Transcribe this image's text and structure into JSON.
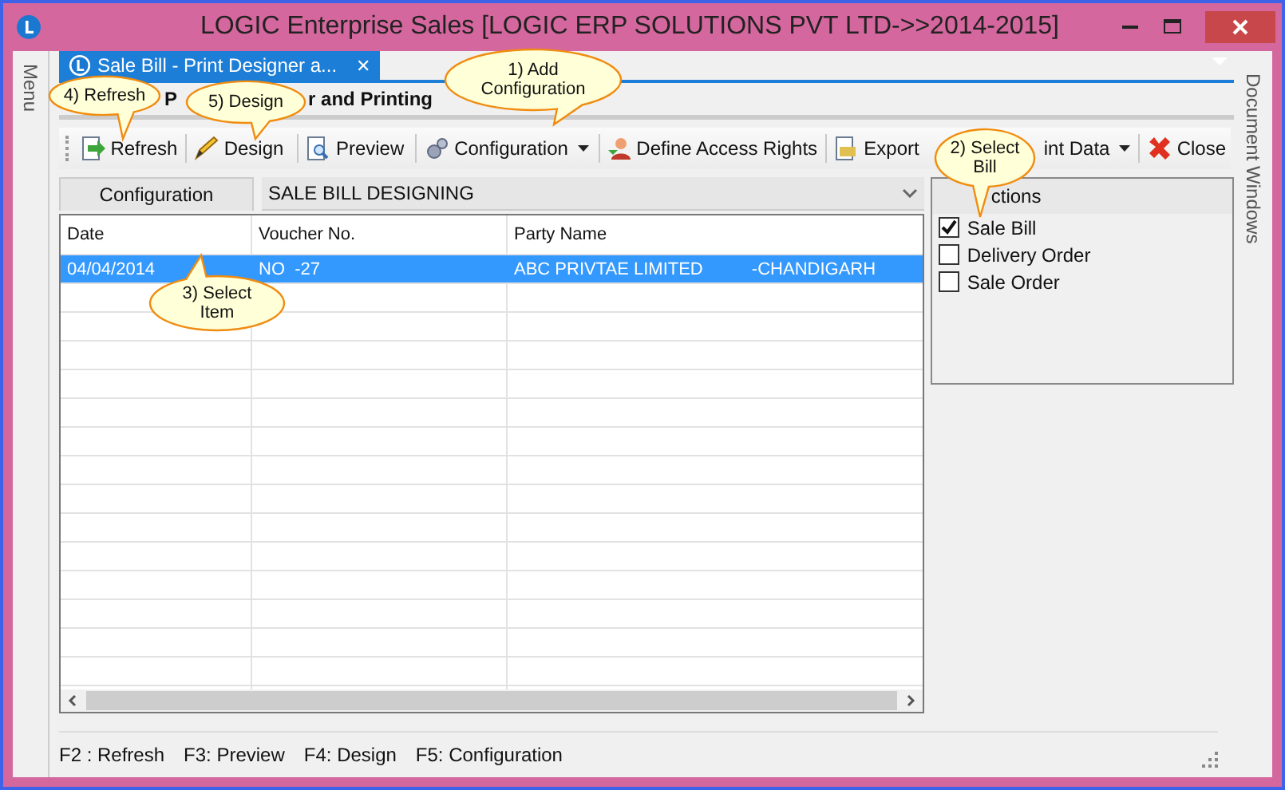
{
  "window": {
    "title": "LOGIC Enterprise Sales  [LOGIC ERP SOLUTIONS PVT LTD->>2014-2015]"
  },
  "side_left": {
    "label": "Menu"
  },
  "side_right": {
    "label": "Document Windows"
  },
  "tab": {
    "label": "Sale Bill - Print Designer a...",
    "close": "✕",
    "selected": true
  },
  "form_title": {
    "before": "P",
    "after": "r and Printing"
  },
  "toolbar": [
    {
      "label": "Refresh",
      "dropdown": false
    },
    {
      "label": "Design",
      "dropdown": false
    },
    {
      "label": "Preview",
      "dropdown": false
    },
    {
      "label": "Configuration",
      "dropdown": true
    },
    {
      "label": "Define Access Rights",
      "dropdown": false
    },
    {
      "label": "Export",
      "dropdown": false
    },
    {
      "label": "int Data",
      "dropdown": true
    },
    {
      "label": "Close",
      "dropdown": false
    }
  ],
  "configuration": {
    "label": "Configuration",
    "value": "SALE BILL DESIGNING"
  },
  "table": {
    "columns": [
      "Date",
      "Voucher No.",
      "Party Name"
    ],
    "rows": [
      {
        "cells": [
          "04/04/2014",
          "NO  -27",
          "ABC PRIVTAE LIMITED          -CHANDIGARH"
        ],
        "selected": true
      }
    ]
  },
  "sections": {
    "header": "ctions",
    "items": [
      {
        "label": "Sale Bill",
        "checked": true
      },
      {
        "label": "Delivery Order",
        "checked": false
      },
      {
        "label": "Sale Order",
        "checked": false
      }
    ]
  },
  "status_bar": [
    "F2 : Refresh",
    "F3:  Preview",
    "F4: Design",
    "F5: Configuration"
  ],
  "callouts": [
    {
      "lines": [
        "1)  Add",
        "Configuration"
      ]
    },
    {
      "lines": [
        "2) Select",
        "Bill"
      ]
    },
    {
      "lines": [
        "3) Select",
        "Item"
      ]
    },
    {
      "lines": [
        "4) Refresh"
      ]
    },
    {
      "lines": [
        "5) Design"
      ]
    }
  ]
}
